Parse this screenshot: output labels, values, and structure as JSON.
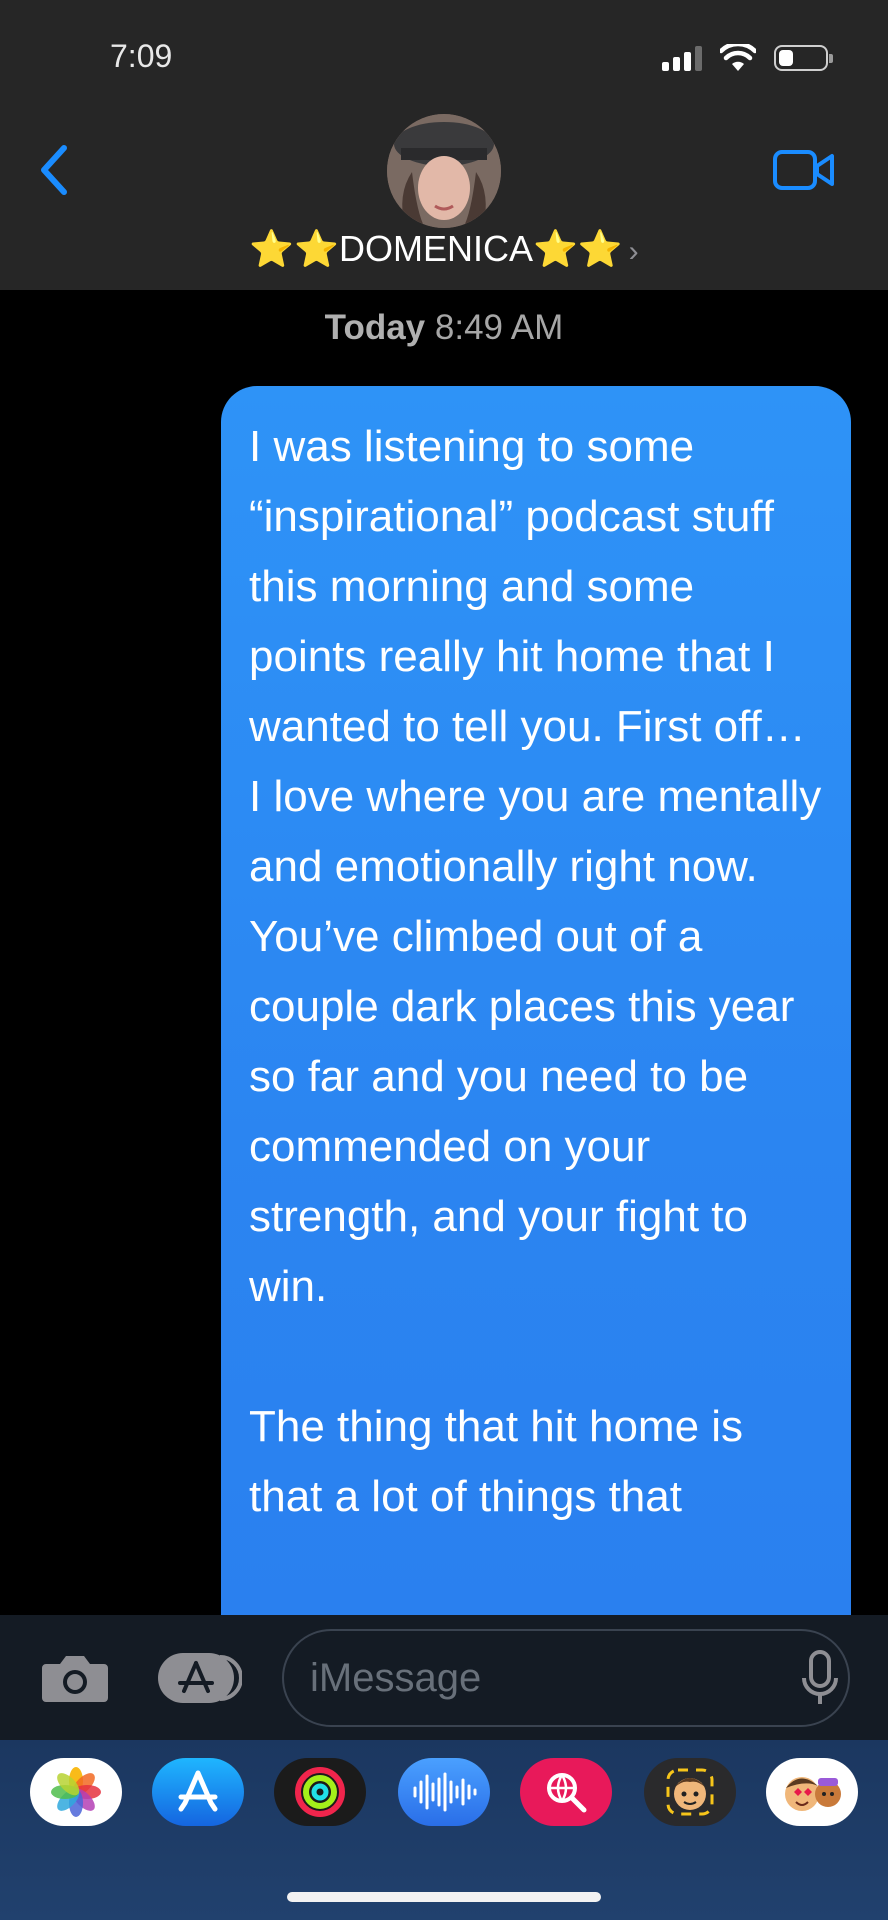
{
  "status_bar": {
    "time": "7:09"
  },
  "header": {
    "contact_name": "⭐⭐DOMENICA⭐⭐",
    "chevron": "›",
    "back_icon": "chevron-left-icon",
    "video_icon": "video-camera-icon"
  },
  "conversation": {
    "timestamp_day": "Today",
    "timestamp_time": "8:49 AM",
    "message": "I was listening to some “inspirational” podcast stuff this morning and some points really hit home that I wanted to tell you. First off… I love where you are mentally and emotionally right now. You’ve climbed out of a couple dark places this year so far and you need to be commended on your strength, and your fight to win.\n\nThe thing that hit home is that a lot of things that"
  },
  "compose": {
    "placeholder": "iMessage",
    "camera_icon": "camera-icon",
    "apps_icon": "app-store-icon",
    "mic_icon": "microphone-icon"
  },
  "app_strip": {
    "apps": [
      "photos-icon",
      "app-store-icon",
      "activity-icon",
      "audio-message-icon",
      "web-search-icon",
      "memoji-icon",
      "memoji-stickers-icon"
    ]
  },
  "colors": {
    "bubble_blue": "#2b88f3",
    "accent_blue": "#1a8cff",
    "header_bg": "#262626"
  }
}
